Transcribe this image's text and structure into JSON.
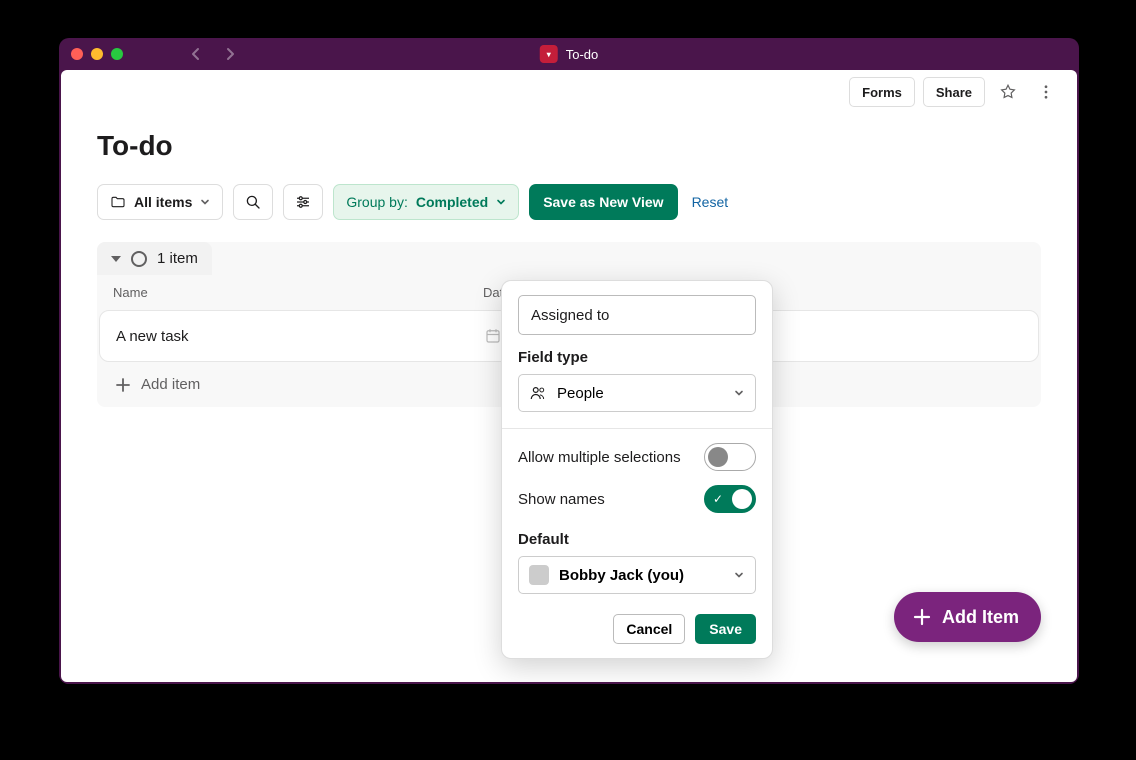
{
  "window": {
    "title": "To-do"
  },
  "topbar": {
    "forms": "Forms",
    "share": "Share"
  },
  "page": {
    "title": "To-do"
  },
  "toolbar": {
    "all_items": "All items",
    "group_by_label": "Group by:",
    "group_by_value": "Completed",
    "save_view": "Save as New View",
    "reset": "Reset"
  },
  "group": {
    "count_label": "1 item",
    "columns": {
      "name": "Name",
      "date": "Date"
    },
    "tasks": [
      {
        "name": "A new task"
      }
    ],
    "add_item": "Add item"
  },
  "popover": {
    "name_value": "Assigned to",
    "field_type_label": "Field type",
    "field_type_value": "People",
    "allow_multiple_label": "Allow multiple selections",
    "allow_multiple_on": false,
    "show_names_label": "Show names",
    "show_names_on": true,
    "default_label": "Default",
    "default_value": "Bobby Jack (you)",
    "cancel": "Cancel",
    "save": "Save"
  },
  "fab": {
    "label": "Add Item"
  }
}
